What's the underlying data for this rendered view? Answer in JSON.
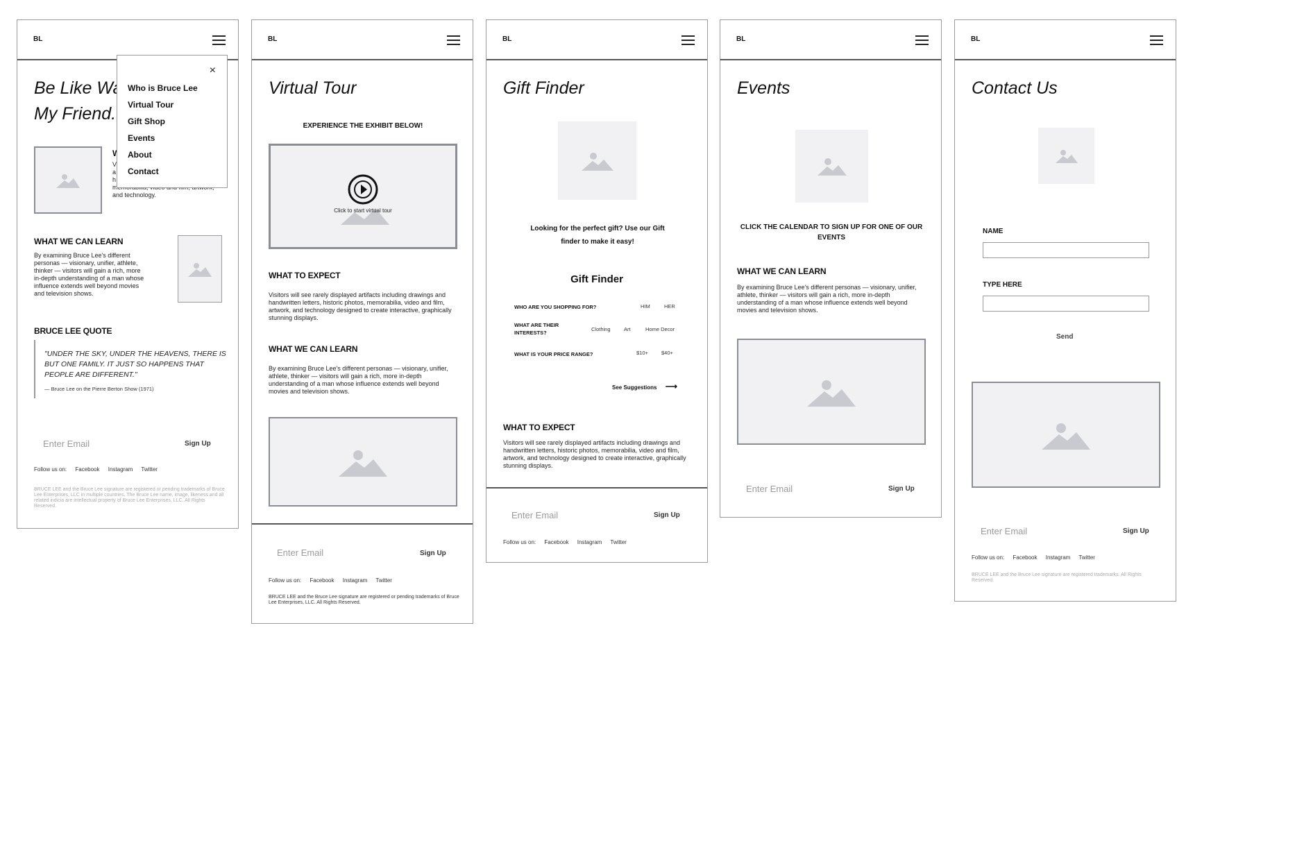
{
  "logo": "BL",
  "menu": {
    "close_glyph": "×",
    "items": [
      "Who is Bruce Lee",
      "Virtual Tour",
      "Gift Shop",
      "Events",
      "About",
      "Contact"
    ]
  },
  "footer": {
    "email_placeholder": "Enter Email",
    "signup": "Sign Up",
    "follow_label": "Follow us on:",
    "facebook": "Facebook",
    "instagram": "Instagram",
    "twitter": "Twitter"
  },
  "home": {
    "title_line1": "Be Like Wa",
    "title_line2": "My Friend..",
    "partial_heading": "W",
    "partial_text": "V\na\nh\nmemorabilia, video and film, artwork,\nand technology.",
    "learn_heading": "WHAT WE CAN LEARN",
    "learn_text": "By examining Bruce Lee's different personas — visionary, unifier, athlete, thinker — visitors will gain a rich, more in-depth understanding of a man whose influence extends well beyond movies and television shows.",
    "quote_heading": "BRUCE LEE QUOTE",
    "quote_text": "\"UNDER THE SKY, UNDER THE HEAVENS, THERE IS BUT ONE FAMILY. IT JUST SO HAPPENS THAT PEOPLE ARE DIFFERENT.\"",
    "quote_source": "— Bruce Lee on the Pierre Berton Show (1971)",
    "legal": "BRUCE LEE and the Bruce Lee signature are registered or pending trademarks of Bruce Lee Enterprises, LLC in multiple countries. The Bruce Lee name, image, likeness and all related indicia are intellectual property of Bruce Lee Enterprises, LLC. All Rights Reserved."
  },
  "tour": {
    "title": "Virtual Tour",
    "experience": "EXPERIENCE THE EXHIBIT BELOW!",
    "play_caption": "Click to start virtual tour",
    "expect_heading": "WHAT TO EXPECT",
    "expect_text": "Visitors will see rarely displayed artifacts including drawings and handwritten letters, historic photos, memorabilia, video and film, artwork, and technology designed to create interactive, graphically stunning displays.",
    "learn_heading": "WHAT WE CAN LEARN",
    "learn_text": "By examining Bruce Lee's different personas — visionary, unifier, athlete, thinker — visitors will gain a rich, more in-depth understanding of a man whose influence extends well beyond movies and television shows.",
    "legal": "BRUCE LEE and the Bruce Lee signature are registered or pending trademarks of Bruce Lee Enterprises, LLC. All Rights Reserved."
  },
  "gift": {
    "title": "Gift Finder",
    "intro": "Looking for the perfect gift? Use our Gift finder to make it easy!",
    "finder_title": "Gift Finder",
    "q1": "WHO ARE YOU SHOPPING FOR?",
    "q1_opts": [
      "HIM",
      "HER"
    ],
    "q2": "WHAT ARE THEIR INTERESTS?",
    "q2_opts": [
      "Clothing",
      "Art",
      "Home Decor"
    ],
    "q3": "WHAT IS YOUR PRICE RANGE?",
    "q3_opts": [
      "$10+",
      "$40+"
    ],
    "suggestions": "See Suggestions",
    "arrow": "⟶",
    "expect_heading": "WHAT TO EXPECT",
    "expect_text": "Visitors will see rarely displayed artifacts including drawings and handwritten letters, historic photos, memorabilia, video and film, artwork, and technology designed to create interactive, graphically stunning displays."
  },
  "events": {
    "title": "Events",
    "cta": "CLICK THE CALENDAR TO SIGN UP FOR ONE OF OUR EVENTS",
    "learn_heading": "WHAT WE CAN LEARN",
    "learn_text": "By examining Bruce Lee's different personas — visionary, unifier, athlete, thinker — visitors will gain a rich, more in-depth understanding of a man whose influence extends well beyond movies and television shows."
  },
  "contact": {
    "title": "Contact Us",
    "name_label": "NAME",
    "type_label": "TYPE HERE",
    "send": "Send",
    "legal": "BRUCE LEE and the Bruce Lee signature are registered trademarks. All Rights Reserved."
  },
  "colors": {
    "placeholder_bg": "#f1f1f3",
    "placeholder_glyph": "#c9cad0",
    "frame_border": "#9a9a9a",
    "divider": "#555555"
  }
}
